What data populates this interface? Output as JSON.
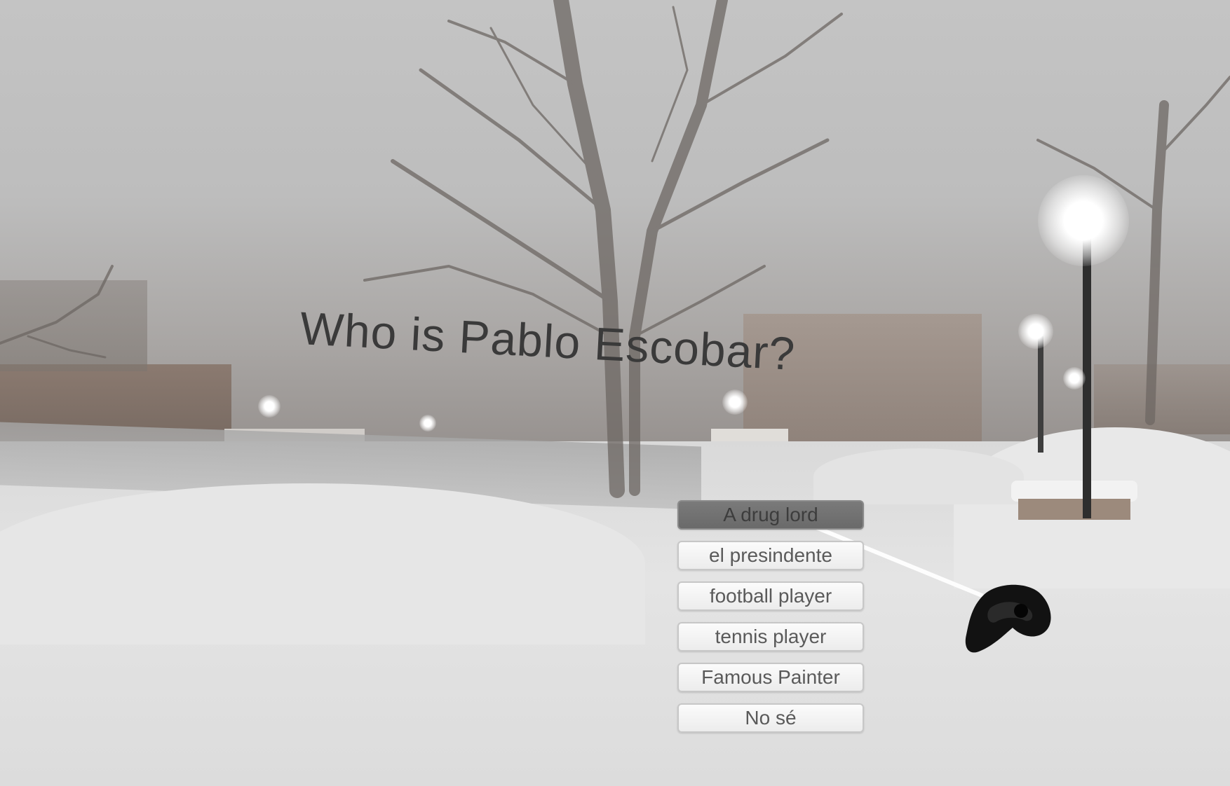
{
  "question": {
    "text": "Who is Pablo Escobar?"
  },
  "answers": [
    {
      "label": "A drug lord",
      "selected": true
    },
    {
      "label": "el presindente",
      "selected": false
    },
    {
      "label": "football player",
      "selected": false
    },
    {
      "label": "tennis player",
      "selected": false
    },
    {
      "label": "Famous Painter",
      "selected": false
    },
    {
      "label": "No sé",
      "selected": false
    }
  ],
  "colors": {
    "selected_button": "#707070",
    "button": "#f5f5f5",
    "question_text": "#3a3a3a",
    "laser": "#ffffff",
    "controller": "#111111"
  },
  "icons": {
    "controller": "vr-controller-icon"
  }
}
